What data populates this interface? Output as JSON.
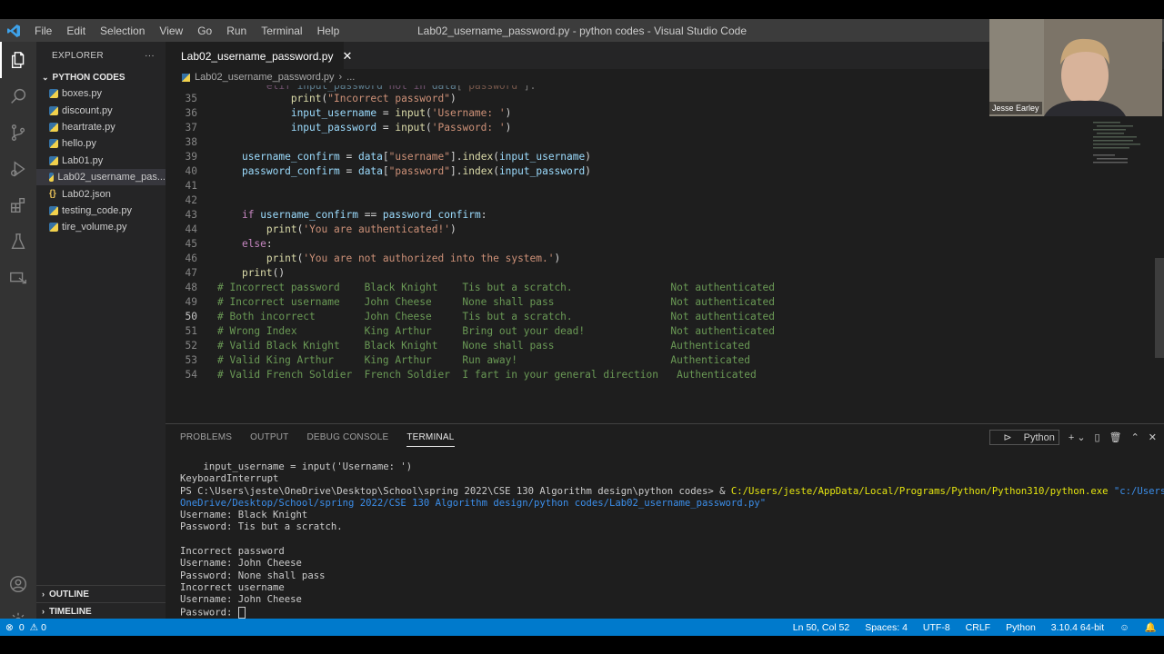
{
  "title_bar": {
    "menu": [
      "File",
      "Edit",
      "Selection",
      "View",
      "Go",
      "Run",
      "Terminal",
      "Help"
    ],
    "window_title": "Lab02_username_password.py - python codes - Visual Studio Code"
  },
  "sidebar": {
    "header": "EXPLORER",
    "folder": "PYTHON CODES",
    "files": [
      {
        "name": "boxes.py",
        "type": "py"
      },
      {
        "name": "discount.py",
        "type": "py"
      },
      {
        "name": "heartrate.py",
        "type": "py"
      },
      {
        "name": "hello.py",
        "type": "py"
      },
      {
        "name": "Lab01.py",
        "type": "py"
      },
      {
        "name": "Lab02_username_pas...",
        "type": "py",
        "selected": true
      },
      {
        "name": "Lab02.json",
        "type": "json"
      },
      {
        "name": "testing_code.py",
        "type": "py"
      },
      {
        "name": "tire_volume.py",
        "type": "py"
      }
    ],
    "outline": "OUTLINE",
    "timeline": "TIMELINE"
  },
  "editor": {
    "tab_label": "Lab02_username_password.py",
    "breadcrumb": [
      "Lab02_username_password.py",
      "..."
    ],
    "current_line": 50,
    "line_numbers": [
      "35",
      "36",
      "37",
      "38",
      "39",
      "40",
      "41",
      "42",
      "43",
      "44",
      "45",
      "46",
      "47",
      "48",
      "49",
      "50",
      "51",
      "52",
      "53",
      "54"
    ]
  },
  "panel": {
    "tabs": [
      "PROBLEMS",
      "OUTPUT",
      "DEBUG CONSOLE",
      "TERMINAL"
    ],
    "active_tab": "TERMINAL",
    "shell": "Python",
    "terminal": {
      "l1": "    input_username = input('Username: ')",
      "l2": "KeyboardInterrupt",
      "ps_prefix": "PS C:\\Users\\jeste\\OneDrive\\Desktop\\School\\spring 2022\\CSE 130 Algorithm design\\python codes> & ",
      "exe": "C:/Users/jeste/AppData/Local/Programs/Python/Python310/python.exe",
      "script_a": " \"c:/Users/jeste/",
      "script_b": "OneDrive/Desktop/School/spring 2022/CSE 130 Algorithm design/python codes/Lab02_username_password.py\"",
      "l5": "Username: Black Knight",
      "l6": "Password: Tis but a scratch.",
      "l7": "",
      "l8": "Incorrect password",
      "l9": "Username: John Cheese",
      "l10": "Password: None shall pass",
      "l11": "Incorrect username",
      "l12": "Username: John Cheese",
      "l13": "Password: "
    }
  },
  "status_bar": {
    "errors": "0",
    "warnings": "0",
    "position": "Ln 50, Col 52",
    "spaces": "Spaces: 4",
    "encoding": "UTF-8",
    "eol": "CRLF",
    "language": "Python",
    "interpreter": "3.10.4 64-bit"
  },
  "webcam": {
    "name": "Jesse Earley"
  },
  "colors": {
    "status_bar": "#007acc",
    "editor_bg": "#1e1e1e",
    "sidebar_bg": "#252526",
    "activity_bg": "#333333"
  }
}
